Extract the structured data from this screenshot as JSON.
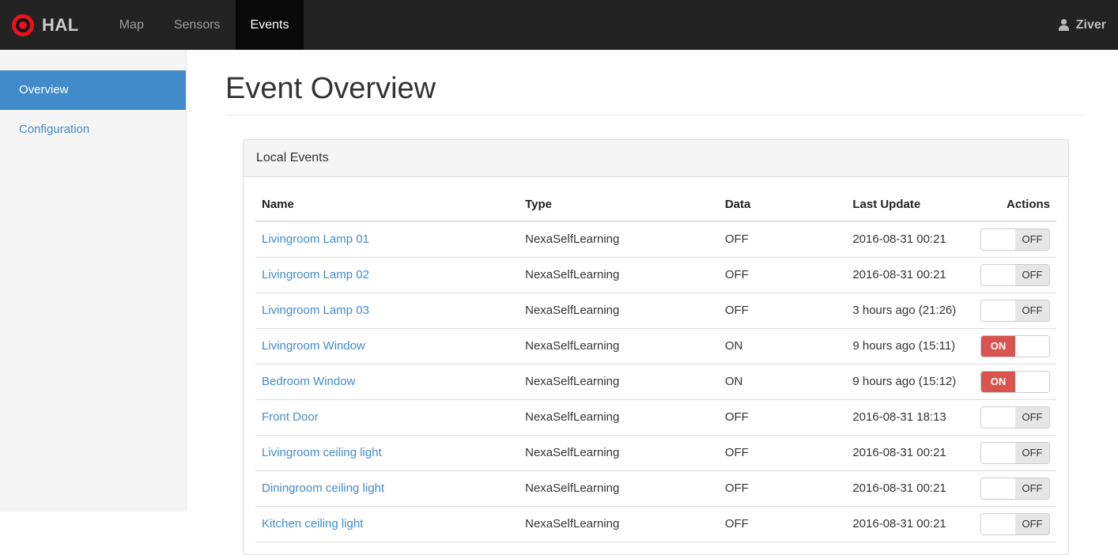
{
  "colors": {
    "navbar_bg": "#222222",
    "navbar_active_bg": "#090909",
    "accent_blue": "#428bca",
    "toggle_on_red": "#d9534f",
    "panel_header_bg": "#f5f5f5",
    "logo_red": "#e8121d"
  },
  "navbar": {
    "brand": "HAL",
    "logo_icon": "bullseye-icon",
    "items": [
      {
        "label": "Map",
        "active": false
      },
      {
        "label": "Sensors",
        "active": false
      },
      {
        "label": "Events",
        "active": true
      }
    ],
    "user": {
      "icon": "person-icon",
      "name": "Ziver"
    }
  },
  "sidebar": {
    "items": [
      {
        "label": "Overview",
        "active": true
      },
      {
        "label": "Configuration",
        "active": false
      }
    ]
  },
  "main": {
    "title": "Event Overview",
    "panel": {
      "title": "Local Events",
      "table": {
        "columns": [
          "Name",
          "Type",
          "Data",
          "Last Update",
          "Actions"
        ],
        "rows": [
          {
            "name": "Livingroom Lamp 01",
            "type": "NexaSelfLearning",
            "data": "OFF",
            "last_update": "2016-08-31 00:21",
            "toggle": "OFF"
          },
          {
            "name": "Livingroom Lamp 02",
            "type": "NexaSelfLearning",
            "data": "OFF",
            "last_update": "2016-08-31 00:21",
            "toggle": "OFF"
          },
          {
            "name": "Livingroom Lamp 03",
            "type": "NexaSelfLearning",
            "data": "OFF",
            "last_update": "3 hours ago (21:26)",
            "toggle": "OFF"
          },
          {
            "name": "Livingroom Window",
            "type": "NexaSelfLearning",
            "data": "ON",
            "last_update": "9 hours ago (15:11)",
            "toggle": "ON"
          },
          {
            "name": "Bedroom Window",
            "type": "NexaSelfLearning",
            "data": "ON",
            "last_update": "9 hours ago (15:12)",
            "toggle": "ON"
          },
          {
            "name": "Front Door",
            "type": "NexaSelfLearning",
            "data": "OFF",
            "last_update": "2016-08-31 18:13",
            "toggle": "OFF"
          },
          {
            "name": "Livingroom ceiling light",
            "type": "NexaSelfLearning",
            "data": "OFF",
            "last_update": "2016-08-31 00:21",
            "toggle": "OFF"
          },
          {
            "name": "Diningroom ceiling light",
            "type": "NexaSelfLearning",
            "data": "OFF",
            "last_update": "2016-08-31 00:21",
            "toggle": "OFF"
          },
          {
            "name": "Kitchen ceiling light",
            "type": "NexaSelfLearning",
            "data": "OFF",
            "last_update": "2016-08-31 00:21",
            "toggle": "OFF"
          }
        ]
      }
    }
  }
}
